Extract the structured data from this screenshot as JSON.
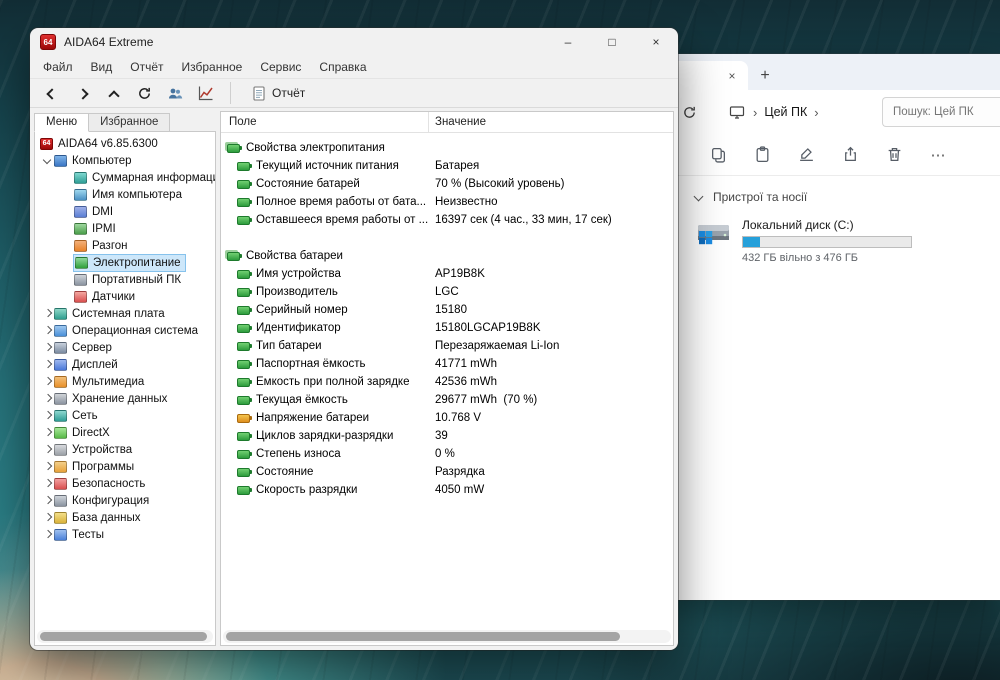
{
  "colors": {
    "selection_blue": "#cde7fa",
    "battery_green": "#2d9c3d",
    "drive_bar_blue": "#26a0da",
    "aida_logo_red": "#9c0808"
  },
  "aida": {
    "logo_text": "64",
    "title": "AIDA64 Extreme",
    "window_controls": {
      "minimize": "–",
      "maximize": "□",
      "close": "×"
    },
    "menu": [
      "Файл",
      "Вид",
      "Отчёт",
      "Избранное",
      "Сервис",
      "Справка"
    ],
    "toolbar": {
      "report": "Отчёт"
    },
    "tabs": {
      "menu": "Меню",
      "favorites": "Избранное"
    },
    "tree": [
      {
        "label": "AIDA64 v6.85.6300"
      },
      {
        "label": "Компьютер"
      },
      {
        "label": "Суммарная информация"
      },
      {
        "label": "Имя компьютера"
      },
      {
        "label": "DMI"
      },
      {
        "label": "IPMI"
      },
      {
        "label": "Разгон"
      },
      {
        "label": "Электропитание"
      },
      {
        "label": "Портативный ПК"
      },
      {
        "label": "Датчики"
      },
      {
        "label": "Системная плата"
      },
      {
        "label": "Операционная система"
      },
      {
        "label": "Сервер"
      },
      {
        "label": "Дисплей"
      },
      {
        "label": "Мультимедиа"
      },
      {
        "label": "Хранение данных"
      },
      {
        "label": "Сеть"
      },
      {
        "label": "DirectX"
      },
      {
        "label": "Устройства"
      },
      {
        "label": "Программы"
      },
      {
        "label": "Безопасность"
      },
      {
        "label": "Конфигурация"
      },
      {
        "label": "База данных"
      },
      {
        "label": "Тесты"
      }
    ],
    "table": {
      "columns": {
        "field": "Поле",
        "value": "Значение"
      },
      "rows": [
        {
          "kind": "section",
          "field": "Свойства электропитания",
          "value": ""
        },
        {
          "kind": "item",
          "field": "Текущий источник питания",
          "value": "Батарея"
        },
        {
          "kind": "item",
          "field": "Состояние батарей",
          "value": "70 % (Высокий уровень)"
        },
        {
          "kind": "item",
          "field": "Полное время работы от бата...",
          "value": "Неизвестно"
        },
        {
          "kind": "item",
          "field": "Оставшееся время работы от ...",
          "value": "16397 сек (4 час., 33 мин, 17 сек)"
        },
        {
          "kind": "blank",
          "field": "",
          "value": ""
        },
        {
          "kind": "section",
          "field": "Свойства батареи",
          "value": ""
        },
        {
          "kind": "item",
          "field": "Имя устройства",
          "value": "AP19B8K"
        },
        {
          "kind": "item",
          "field": "Производитель",
          "value": "LGC"
        },
        {
          "kind": "item",
          "field": "Серийный номер",
          "value": "15180"
        },
        {
          "kind": "item",
          "field": "Идентификатор",
          "value": "15180LGCAP19B8K"
        },
        {
          "kind": "item",
          "field": "Тип батареи",
          "value": "Перезаряжаемая Li-Ion"
        },
        {
          "kind": "item",
          "field": "Паспортная ёмкость",
          "value": "41771 mWh"
        },
        {
          "kind": "item",
          "field": "Ёмкость при полной зарядке",
          "value": "42536 mWh"
        },
        {
          "kind": "item",
          "field": "Текущая ёмкость",
          "value": "29677 mWh  (70 %)"
        },
        {
          "kind": "item",
          "field": "Напряжение батареи",
          "value": "10.768 V"
        },
        {
          "kind": "item",
          "field": "Циклов зарядки-разрядки",
          "value": "39"
        },
        {
          "kind": "item",
          "field": "Степень износа",
          "value": "0 %"
        },
        {
          "kind": "item",
          "field": "Состояние",
          "value": "Разрядка"
        },
        {
          "kind": "item",
          "field": "Скорость разрядки",
          "value": "4050 mW"
        }
      ]
    }
  },
  "explorer": {
    "tab_close": "×",
    "new_tab": "+",
    "breadcrumb": {
      "this_pc": "Цей ПК",
      "chevron": "›"
    },
    "search_placeholder": "Пошук: Цей ПК",
    "more": "⋯",
    "devices_section": "Пристрої та носії",
    "drive": {
      "name": "Локальний диск (C:)",
      "free": "432 ГБ вільно з 476 ГБ",
      "used_percent": 10
    }
  }
}
